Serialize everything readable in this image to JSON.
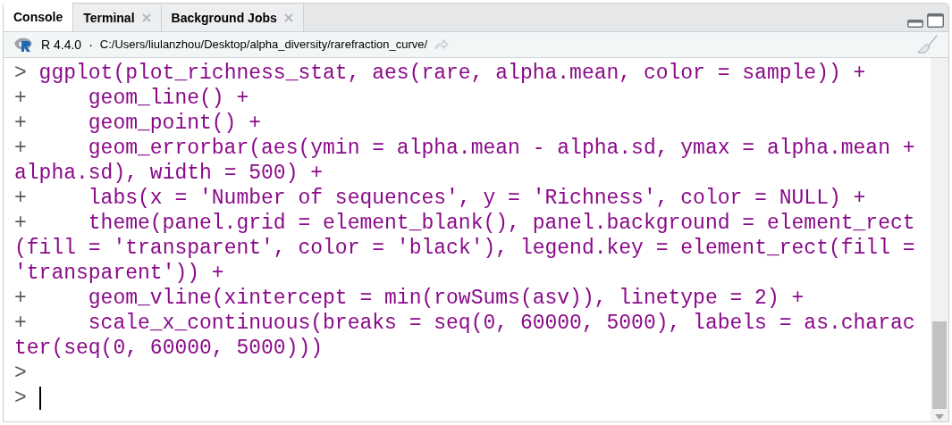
{
  "tabs": [
    {
      "label": "Console",
      "selected": true,
      "closable": false
    },
    {
      "label": "Terminal",
      "selected": false,
      "closable": true
    },
    {
      "label": "Background Jobs",
      "selected": false,
      "closable": true
    }
  ],
  "path_bar": {
    "version": "R 4.4.0",
    "separator": "·",
    "path": "C:/Users/liulanzhou/Desktop/alpha_diversity/rarefraction_curve/"
  },
  "console": {
    "lines": [
      {
        "kind": "input",
        "prompt": ">",
        "text": "ggplot(plot_richness_stat, aes(rare, alpha.mean, color = sample)) +"
      },
      {
        "kind": "continuation",
        "prompt": "+",
        "text": "geom_line() +"
      },
      {
        "kind": "continuation",
        "prompt": "+",
        "text": "geom_point() +"
      },
      {
        "kind": "continuation",
        "prompt": "+",
        "text": "geom_errorbar(aes(ymin = alpha.mean - alpha.sd, ymax = alpha.mean +"
      },
      {
        "kind": "wrap",
        "text": "alpha.sd), width = 500) +"
      },
      {
        "kind": "continuation",
        "prompt": "+",
        "text": "labs(x = 'Number of sequences', y = 'Richness', color = NULL) +"
      },
      {
        "kind": "continuation",
        "prompt": "+",
        "text": "theme(panel.grid = element_blank(), panel.background = element_rect"
      },
      {
        "kind": "wrap",
        "text": "(fill = 'transparent', color = 'black'), legend.key = element_rect(fill ="
      },
      {
        "kind": "wrap",
        "text": "'transparent')) +"
      },
      {
        "kind": "continuation",
        "prompt": "+",
        "text": "geom_vline(xintercept = min(rowSums(asv)), linetype = 2) +"
      },
      {
        "kind": "continuation",
        "prompt": "+",
        "text": "scale_x_continuous(breaks = seq(0, 60000, 5000), labels = as.charac"
      },
      {
        "kind": "wrap",
        "text": "ter(seq(0, 60000, 5000)))"
      },
      {
        "kind": "input",
        "prompt": ">"
      },
      {
        "kind": "cursor",
        "prompt": ">"
      }
    ]
  }
}
